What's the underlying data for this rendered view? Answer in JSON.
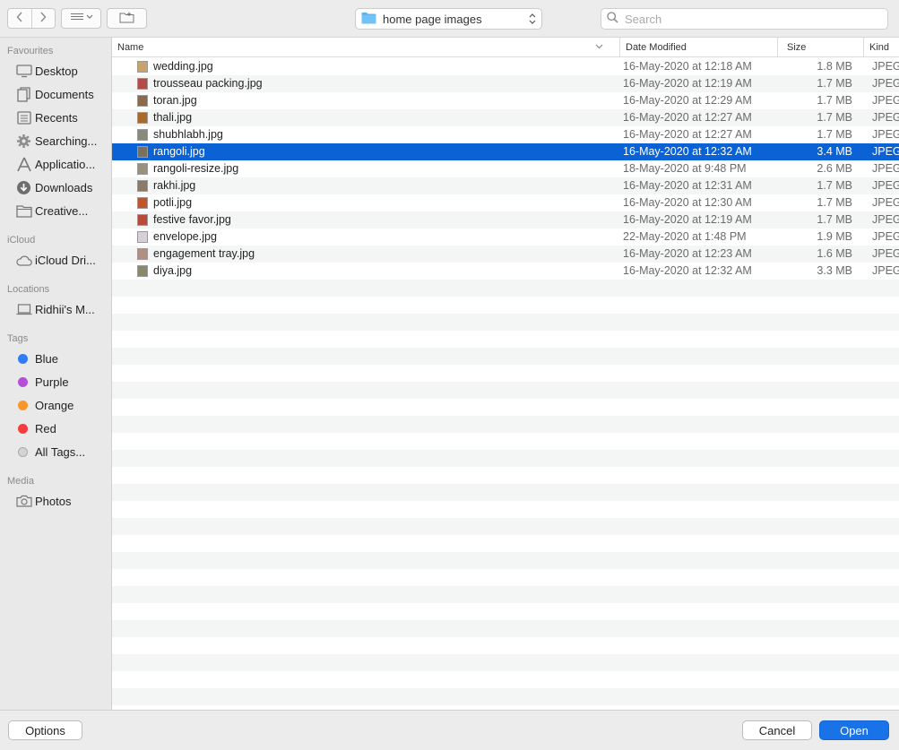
{
  "toolbar": {
    "location": "home page images",
    "search_placeholder": "Search"
  },
  "sidebar": {
    "favourites_label": "Favourites",
    "favourites": [
      {
        "label": "Desktop",
        "icon": "desktop-icon"
      },
      {
        "label": "Documents",
        "icon": "documents-icon"
      },
      {
        "label": "Recents",
        "icon": "recents-icon"
      },
      {
        "label": "Searching...",
        "icon": "gear-icon"
      },
      {
        "label": "Applicatio...",
        "icon": "applications-icon"
      },
      {
        "label": "Downloads",
        "icon": "downloads-icon"
      },
      {
        "label": "Creative...",
        "icon": "folder-icon"
      }
    ],
    "icloud_label": "iCloud",
    "icloud": [
      {
        "label": "iCloud Dri...",
        "icon": "cloud-icon"
      }
    ],
    "locations_label": "Locations",
    "locations": [
      {
        "label": "Ridhii's M...",
        "icon": "laptop-icon"
      }
    ],
    "tags_label": "Tags",
    "tags": [
      {
        "label": "Blue",
        "color": "#2e7cf6"
      },
      {
        "label": "Purple",
        "color": "#b44fd8"
      },
      {
        "label": "Orange",
        "color": "#f7962a"
      },
      {
        "label": "Red",
        "color": "#f33d3d"
      },
      {
        "label": "All Tags...",
        "color": "#d0d0d0"
      }
    ],
    "media_label": "Media",
    "media": [
      {
        "label": "Photos",
        "icon": "camera-icon"
      }
    ]
  },
  "columns": {
    "name": "Name",
    "date": "Date Modified",
    "size": "Size",
    "kind": "Kind"
  },
  "files": [
    {
      "name": "wedding.jpg",
      "date": "16-May-2020 at 12:18 AM",
      "size": "1.8 MB",
      "kind": "JPEG"
    },
    {
      "name": "trousseau packing.jpg",
      "date": "16-May-2020 at 12:19 AM",
      "size": "1.7 MB",
      "kind": "JPEG"
    },
    {
      "name": "toran.jpg",
      "date": "16-May-2020 at 12:29 AM",
      "size": "1.7 MB",
      "kind": "JPEG"
    },
    {
      "name": "thali.jpg",
      "date": "16-May-2020 at 12:27 AM",
      "size": "1.7 MB",
      "kind": "JPEG"
    },
    {
      "name": "shubhlabh.jpg",
      "date": "16-May-2020 at 12:27 AM",
      "size": "1.7 MB",
      "kind": "JPEG"
    },
    {
      "name": "rangoli.jpg",
      "date": "16-May-2020 at 12:32 AM",
      "size": "3.4 MB",
      "kind": "JPEG"
    },
    {
      "name": "rangoli-resize.jpg",
      "date": "18-May-2020 at 9:48 PM",
      "size": "2.6 MB",
      "kind": "JPEG"
    },
    {
      "name": "rakhi.jpg",
      "date": "16-May-2020 at 12:31 AM",
      "size": "1.7 MB",
      "kind": "JPEG"
    },
    {
      "name": "potli.jpg",
      "date": "16-May-2020 at 12:30 AM",
      "size": "1.7 MB",
      "kind": "JPEG"
    },
    {
      "name": "festive favor.jpg",
      "date": "16-May-2020 at 12:19 AM",
      "size": "1.7 MB",
      "kind": "JPEG"
    },
    {
      "name": "envelope.jpg",
      "date": "22-May-2020 at 1:48 PM",
      "size": "1.9 MB",
      "kind": "JPEG"
    },
    {
      "name": "engagement tray.jpg",
      "date": "16-May-2020 at 12:23 AM",
      "size": "1.6 MB",
      "kind": "JPEG"
    },
    {
      "name": "diya.jpg",
      "date": "16-May-2020 at 12:32 AM",
      "size": "3.3 MB",
      "kind": "JPEG"
    }
  ],
  "selected_index": 5,
  "buttons": {
    "options": "Options",
    "cancel": "Cancel",
    "open": "Open"
  },
  "colors": {
    "selection": "#0a62d4",
    "primary_button": "#1a72e8"
  }
}
